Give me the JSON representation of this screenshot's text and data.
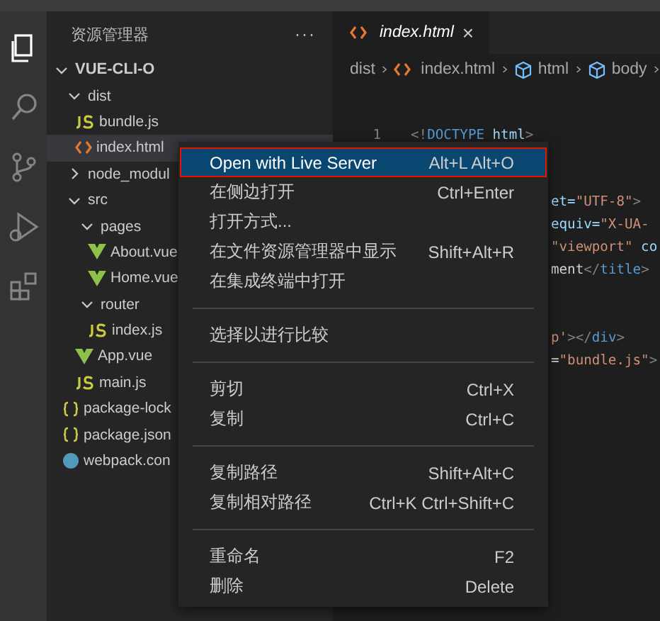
{
  "activity_bar": [
    {
      "kind": "explorer",
      "selected": true
    },
    {
      "kind": "search",
      "selected": false
    },
    {
      "kind": "source-control",
      "selected": false
    },
    {
      "kind": "run",
      "selected": false
    },
    {
      "kind": "extensions",
      "selected": false
    }
  ],
  "sidebar": {
    "title": "资源管理器",
    "more": "···",
    "tree": [
      {
        "label": "VUE-CLI-O",
        "kind": "root",
        "expanded": true,
        "selected": false,
        "children": [
          {
            "label": "dist",
            "kind": "folder",
            "expanded": true,
            "selected": false,
            "children": [
              {
                "label": "bundle.js",
                "kind": "js",
                "selected": false
              },
              {
                "label": "index.html",
                "kind": "html",
                "selected": true
              }
            ]
          },
          {
            "label": "node_modul",
            "kind": "folder",
            "expanded": false,
            "selected": false
          },
          {
            "label": "src",
            "kind": "folder",
            "expanded": true,
            "selected": false,
            "children": [
              {
                "label": "pages",
                "kind": "folder",
                "expanded": true,
                "selected": false,
                "children": [
                  {
                    "label": "About.vue",
                    "kind": "vue",
                    "selected": false
                  },
                  {
                    "label": "Home.vue",
                    "kind": "vue",
                    "selected": false
                  }
                ]
              },
              {
                "label": "router",
                "kind": "folder",
                "expanded": true,
                "selected": false,
                "children": [
                  {
                    "label": "index.js",
                    "kind": "js",
                    "selected": false
                  }
                ]
              },
              {
                "label": "App.vue",
                "kind": "vue",
                "selected": false
              },
              {
                "label": "main.js",
                "kind": "js",
                "selected": false
              }
            ]
          },
          {
            "label": "package-lock",
            "kind": "json",
            "selected": false
          },
          {
            "label": "package.json",
            "kind": "json",
            "selected": false
          },
          {
            "label": "webpack.con",
            "kind": "webpack",
            "selected": false
          }
        ]
      }
    ]
  },
  "editor": {
    "tab": {
      "label": "index.html",
      "close": "×"
    },
    "breadcrumb": [
      {
        "label": "dist",
        "kind": "folder"
      },
      {
        "label": "index.html",
        "kind": "html"
      },
      {
        "label": "html",
        "kind": "element"
      },
      {
        "label": "body",
        "kind": "element"
      }
    ],
    "code_blocks": [
      [
        {
          "number": "1",
          "tokens": [
            {
              "text": "<!",
              "kind": "punct"
            },
            {
              "text": "DOCTYPE",
              "kind": "tag"
            },
            {
              "text": " html",
              "kind": "attr"
            },
            {
              "text": ">",
              "kind": "punct"
            }
          ]
        }
      ],
      [
        {
          "tokens": [
            {
              "text": "et=",
              "kind": "attr"
            },
            {
              "text": "\"UTF-8\"",
              "kind": "string"
            },
            {
              "text": ">",
              "kind": "punct"
            }
          ]
        },
        {
          "tokens": [
            {
              "text": "equiv=",
              "kind": "attr"
            },
            {
              "text": "\"X-UA-",
              "kind": "string"
            }
          ]
        },
        {
          "tokens": [
            {
              "text": "\"viewport\"",
              "kind": "string"
            },
            {
              "text": " co",
              "kind": "attr"
            }
          ]
        },
        {
          "tokens": [
            {
              "text": "ment",
              "kind": "text"
            },
            {
              "text": "</",
              "kind": "punct"
            },
            {
              "text": "title",
              "kind": "tag"
            },
            {
              "text": ">",
              "kind": "punct"
            }
          ]
        }
      ],
      [
        {
          "tokens": [
            {
              "text": "p'",
              "kind": "string"
            },
            {
              "text": ">",
              "kind": "punct"
            },
            {
              "text": "</",
              "kind": "punct"
            },
            {
              "text": "div",
              "kind": "tag"
            },
            {
              "text": ">",
              "kind": "punct"
            }
          ]
        },
        {
          "tokens": [
            {
              "text": "=",
              "kind": "text"
            },
            {
              "text": "\"bundle.js\"",
              "kind": "string"
            },
            {
              "text": ">",
              "kind": "punct"
            }
          ]
        }
      ]
    ]
  },
  "context_menu": {
    "groups": [
      [
        {
          "label": "Open with Live Server",
          "shortcut": "Alt+L Alt+O",
          "selected": true
        },
        {
          "label": "在侧边打开",
          "shortcut": "Ctrl+Enter",
          "selected": false
        },
        {
          "label": "打开方式...",
          "selected": false
        },
        {
          "label": "在文件资源管理器中显示",
          "shortcut": "Shift+Alt+R",
          "selected": false
        },
        {
          "label": "在集成终端中打开",
          "selected": false
        }
      ],
      [
        {
          "label": "选择以进行比较",
          "selected": false
        }
      ],
      [
        {
          "label": "剪切",
          "shortcut": "Ctrl+X",
          "selected": false
        },
        {
          "label": "复制",
          "shortcut": "Ctrl+C",
          "selected": false
        }
      ],
      [
        {
          "label": "复制路径",
          "shortcut": "Shift+Alt+C",
          "selected": false
        },
        {
          "label": "复制相对路径",
          "shortcut": "Ctrl+K Ctrl+Shift+C",
          "selected": false
        }
      ],
      [
        {
          "label": "重命名",
          "shortcut": "F2",
          "selected": false
        },
        {
          "label": "删除",
          "shortcut": "Delete",
          "selected": false
        }
      ]
    ]
  }
}
